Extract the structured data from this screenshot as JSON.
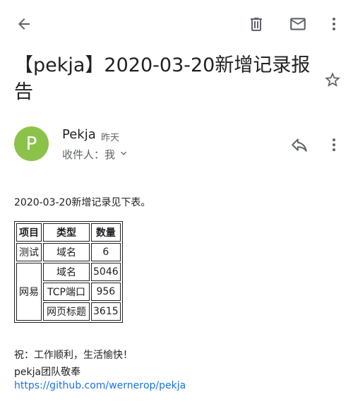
{
  "header": {
    "back_icon": "arrow-left-icon",
    "delete_icon": "trash-icon",
    "mail_icon": "mail-icon",
    "more_icon": "more-vertical-icon"
  },
  "email": {
    "subject": "【pekja】2020-03-20新增记录报告",
    "star_icon": "star-outline-icon",
    "sender": {
      "avatar_letter": "P",
      "avatar_color": "#8bc34a",
      "name": "Pekja",
      "time": "昨天",
      "recipient_label": "收件人：我",
      "reply_icon": "reply-icon"
    },
    "body": {
      "intro": "2020-03-20新增记录见下表。",
      "table": {
        "headers": [
          "项目",
          "类型",
          "数量"
        ],
        "rows": [
          {
            "project": "测试",
            "type": "域名",
            "count": "6"
          },
          {
            "project": "网易",
            "type": "域名",
            "count": "5046"
          },
          {
            "project": "",
            "type": "TCP端口",
            "count": "956"
          },
          {
            "project": "",
            "type": "网页标题",
            "count": "3615"
          }
        ]
      },
      "closing": "祝：工作顺利，生活愉快！",
      "signature": "pekja团队敬奉",
      "link": "https://github.com/wernerор/pekja"
    }
  }
}
